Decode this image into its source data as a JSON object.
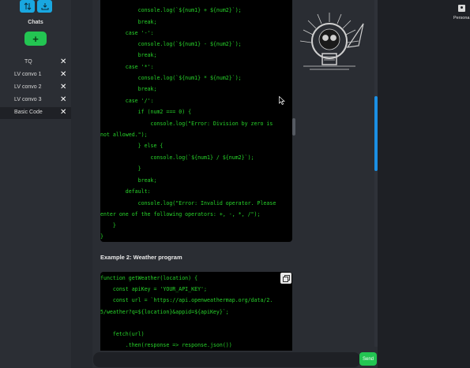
{
  "sidebar": {
    "title": "Chats",
    "new_chat_label": "+",
    "items": [
      {
        "label": "TQ",
        "close": "✕"
      },
      {
        "label": "LV convo 1",
        "close": "✕"
      },
      {
        "label": "LV convo 2",
        "close": "✕"
      },
      {
        "label": "LV convo 3",
        "close": "✕"
      },
      {
        "label": "Basic Code",
        "close": "✕"
      }
    ]
  },
  "code_block_1": {
    "lines": [
      "            console.log(`${num1} + ${num2}`);",
      "            break;",
      "        case '-':",
      "            console.log(`${num1} - ${num2}`);",
      "            break;",
      "        case '*':",
      "            console.log(`${num1} * ${num2}`);",
      "            break;",
      "        case '/':",
      "            if (num2 === 0) {",
      "                console.log(\"Error: Division by zero is",
      "not allowed.\");",
      "            } else {",
      "                console.log(`${num1} / ${num2}`);",
      "            }",
      "            break;",
      "        default:",
      "            console.log(\"Error: Invalid operator. Please",
      "enter one of the following operators: +, -, *, /\");",
      "    }",
      "}"
    ]
  },
  "example_2_title": "Example 2: Weather program",
  "code_block_2": {
    "lines": [
      "function getWeather(location) {",
      "    const apiKey = 'YOUR_API_KEY';",
      "    const url = `https://api.openweathermap.org/data/2.",
      "5/weather?q=${location}&appid=${apiKey}`;",
      "",
      "    fetch(url)",
      "        .then(response => response.json())"
    ]
  },
  "right_panel": {
    "persona_label": "Persona"
  },
  "input": {
    "placeholder": "",
    "value": ""
  },
  "send_label": "Send",
  "colors": {
    "accent_blue": "#19a7e0",
    "accent_green": "#23c552",
    "code_green": "#27d32a"
  }
}
